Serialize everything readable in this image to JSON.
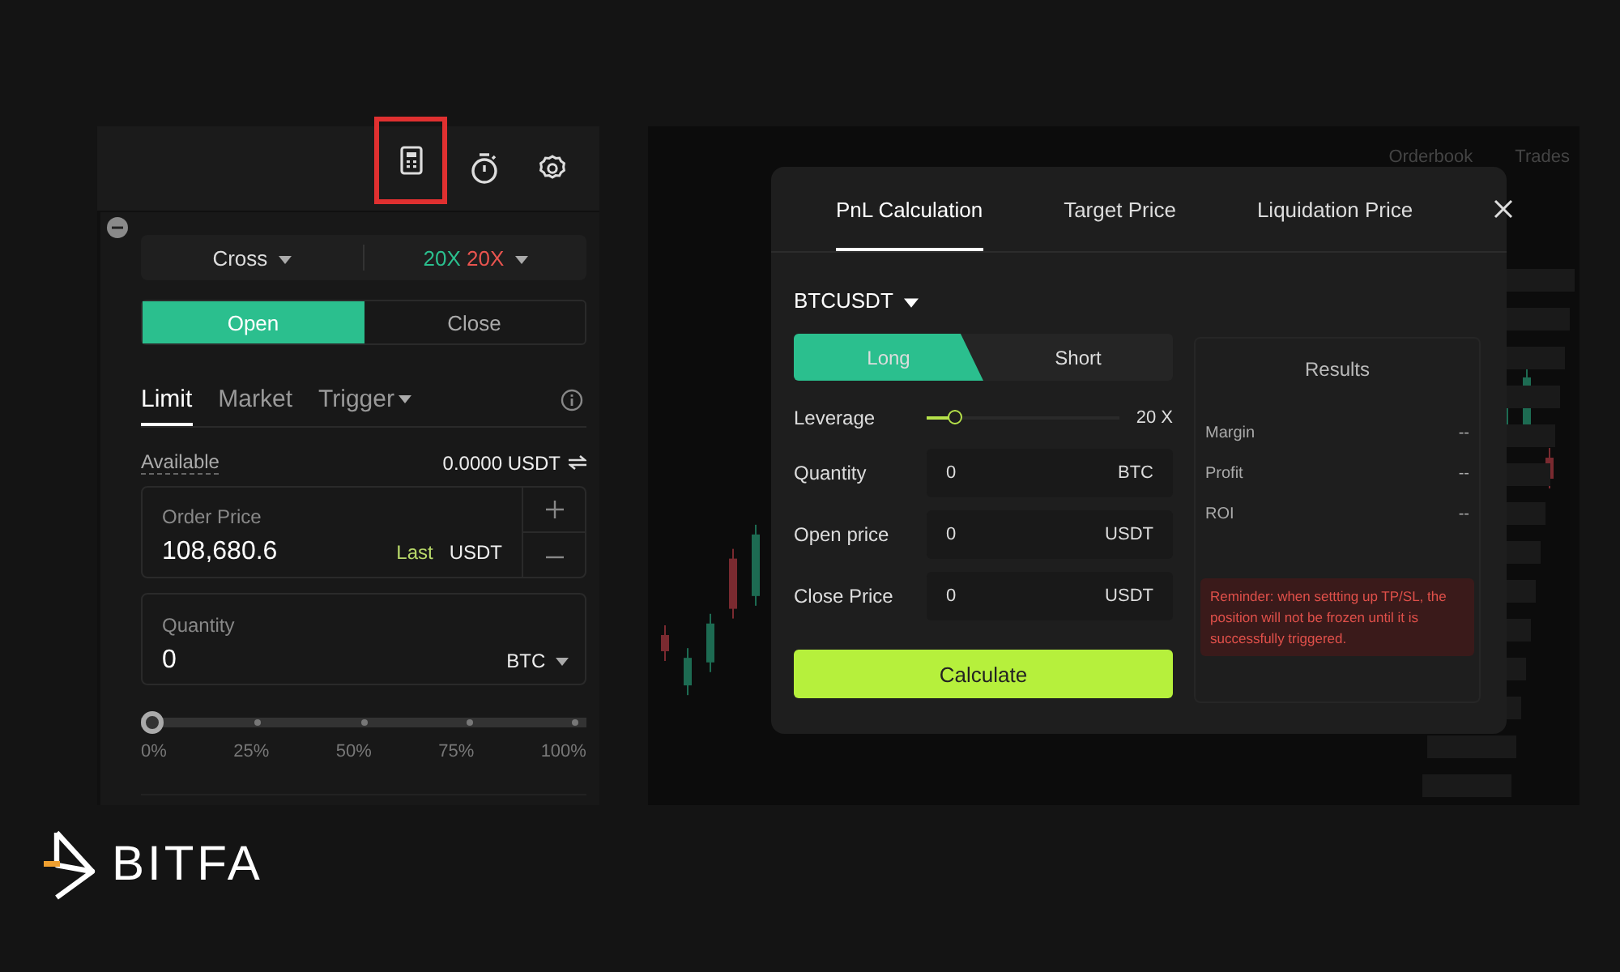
{
  "order_panel": {
    "toolbar": [
      {
        "kind": "calculator",
        "highlighted": true
      },
      {
        "kind": "timer",
        "highlighted": false
      },
      {
        "kind": "settings",
        "highlighted": false
      }
    ],
    "margin_mode": "Cross",
    "leverage_long": "20X",
    "leverage_short": "20X",
    "sides": [
      {
        "label": "Open",
        "selected": true
      },
      {
        "label": "Close",
        "selected": false
      }
    ],
    "order_types": [
      {
        "label": "Limit",
        "selected": true,
        "dropdown": false
      },
      {
        "label": "Market",
        "selected": false,
        "dropdown": false
      },
      {
        "label": "Trigger",
        "selected": false,
        "dropdown": true
      }
    ],
    "available": {
      "label": "Available",
      "value": "0.0000 USDT"
    },
    "order_price": {
      "label": "Order Price",
      "value": "108,680.6",
      "tag": "Last",
      "unit": "USDT"
    },
    "quantity": {
      "label": "Quantity",
      "value": "0",
      "unit": "BTC"
    },
    "slider": {
      "level": 0,
      "ticks": [
        "0%",
        "25%",
        "50%",
        "75%",
        "100%"
      ]
    }
  },
  "chart_panel": {
    "header_labels": [
      "Orderbook",
      "Trades"
    ]
  },
  "calculator": {
    "tabs": [
      {
        "label": "PnL Calculation",
        "selected": true
      },
      {
        "label": "Target Price",
        "selected": false
      },
      {
        "label": "Liquidation Price",
        "selected": false
      }
    ],
    "symbol": "BTCUSDT",
    "directions": [
      {
        "label": "Long",
        "selected": true
      },
      {
        "label": "Short",
        "selected": false
      }
    ],
    "leverage": {
      "label": "Leverage",
      "level": 0.15,
      "reading": "20 X"
    },
    "fields": [
      {
        "label": "Quantity",
        "value": "0",
        "unit": "BTC"
      },
      {
        "label": "Open price",
        "value": "0",
        "unit": "USDT"
      },
      {
        "label": "Close Price",
        "value": "0",
        "unit": "USDT"
      }
    ],
    "button": "Calculate",
    "results": {
      "title": "Results",
      "rows": [
        {
          "label": "Margin",
          "value": "--"
        },
        {
          "label": "Profit",
          "value": "--"
        },
        {
          "label": "ROI",
          "value": "--"
        }
      ]
    },
    "reminder": "Reminder: when settting up TP/SL, the position will not be frozen until it is successfully triggered."
  },
  "brand": {
    "name": "BITFA"
  }
}
